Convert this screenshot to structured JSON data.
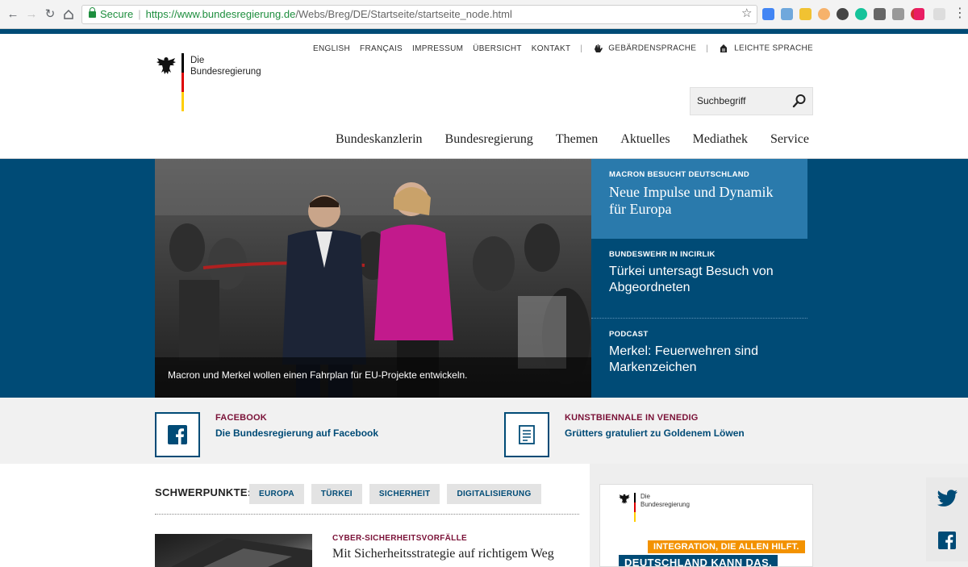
{
  "browser": {
    "secure_label": "Secure",
    "url_scheme_host": "https://www.bundesregierung.de",
    "url_path": "/Webs/Breg/DE/Startseite/startseite_node.html"
  },
  "header": {
    "logo_line1": "Die",
    "logo_line2": "Bundesregierung",
    "meta_nav": [
      "ENGLISH",
      "FRANÇAIS",
      "IMPRESSUM",
      "ÜBERSICHT",
      "KONTAKT"
    ],
    "sign_language": "GEBÄRDENSPRACHE",
    "easy_language": "LEICHTE SPRACHE",
    "search_value": "Suchbegriff",
    "main_nav": [
      "Bundeskanzlerin",
      "Bundesregierung",
      "Themen",
      "Aktuelles",
      "Mediathek",
      "Service"
    ]
  },
  "hero": {
    "caption": "Macron und Merkel wollen einen Fahrplan für EU-Projekte entwickeln.",
    "items": [
      {
        "kicker": "MACRON BESUCHT DEUTSCHLAND",
        "title": "Neue Impulse und Dynamik für Europa"
      },
      {
        "kicker": "BUNDESWEHR IN INCIRLIK",
        "title": "Türkei untersagt Besuch von Abgeordneten"
      },
      {
        "kicker": "PODCAST",
        "title": "Merkel: Feuerwehren sind Markenzeichen"
      }
    ]
  },
  "teasers": [
    {
      "kicker": "FACEBOOK",
      "title": "Die Bundesregierung auf Facebook",
      "icon": "facebook-icon"
    },
    {
      "kicker": "KUNSTBIENNALE IN VENEDIG",
      "title": "Grütters gratuliert zu Goldenem Löwen",
      "icon": "document-icon"
    }
  ],
  "schwerpunkte": {
    "label": "SCHWERPUNKTE:",
    "tags": [
      "EUROPA",
      "TÜRKEI",
      "SICHERHEIT",
      "DIGITALISIERUNG"
    ]
  },
  "article": {
    "kicker": "CYBER-SICHERHEITSVORFÄLLE",
    "title": "Mit Sicherheitsstrategie auf richtigem Weg"
  },
  "ad": {
    "logo_line1": "Die",
    "logo_line2": "Bundesregierung",
    "banner1": "INTEGRATION, DIE ALLEN HILFT.",
    "banner2": "DEUTSCHLAND KANN DAS."
  },
  "colors": {
    "primary_blue": "#004b76",
    "hero_active": "#2a7aac",
    "kicker_red": "#7a1137",
    "ad_orange": "#f39200"
  }
}
